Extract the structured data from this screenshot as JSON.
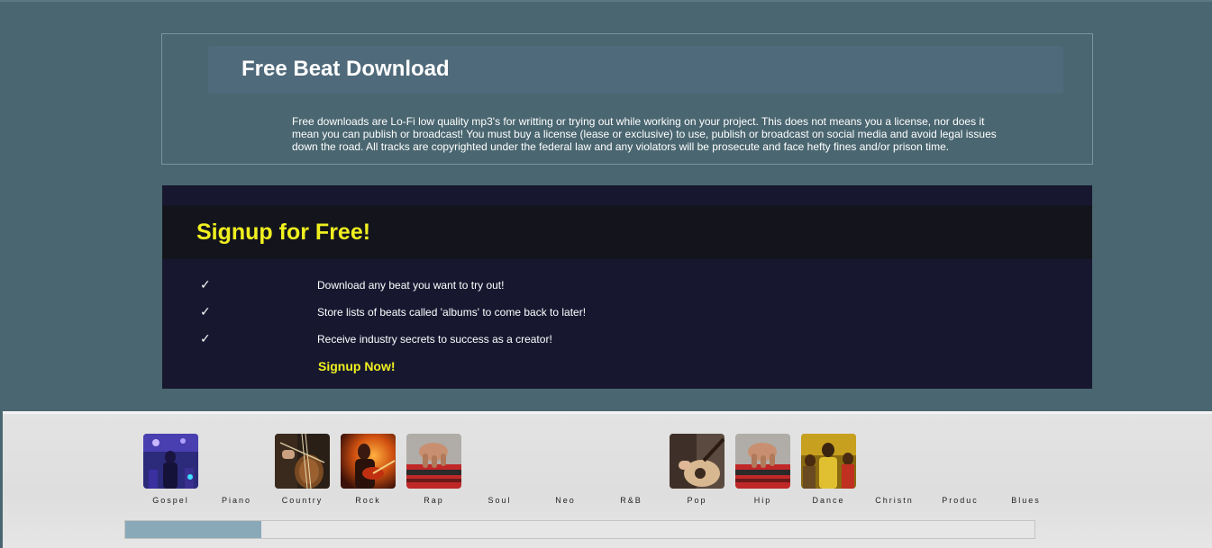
{
  "download": {
    "title": "Free Beat Download",
    "notice": "Free downloads are Lo-Fi low quality mp3's for writting or trying out while working on your project. This does not means you a license, nor does it mean you can publish or broadcast! You must buy a license (lease or exclusive) to use, publish or broadcast on social media and avoid legal issues down the road. All tracks are copyrighted under the federal law and any violators will be prosecute and face hefty fines and/or prison time."
  },
  "signup": {
    "title": "Signup for Free!",
    "check_symbol": "✓",
    "benefits": [
      "Download any beat you want to try out!",
      "Store lists of beats called 'albums' to come back to later!",
      "Receive industry secrets to success as a creator!"
    ],
    "cta": "Signup Now!"
  },
  "genres": [
    {
      "label": "Gospel",
      "thumb": "gospel-stage-icon"
    },
    {
      "label": "Piano",
      "thumb": ""
    },
    {
      "label": "Country",
      "thumb": "cello-icon"
    },
    {
      "label": "Rock",
      "thumb": "guitarist-icon"
    },
    {
      "label": "Rap",
      "thumb": "beat-pad-icon"
    },
    {
      "label": "Soul",
      "thumb": ""
    },
    {
      "label": "Neo",
      "thumb": ""
    },
    {
      "label": "R&B",
      "thumb": ""
    },
    {
      "label": "Pop",
      "thumb": "acoustic-guitar-icon"
    },
    {
      "label": "Hip",
      "thumb": "beat-pad-icon"
    },
    {
      "label": "Dance",
      "thumb": "dance-crowd-icon"
    },
    {
      "label": "Christn",
      "thumb": ""
    },
    {
      "label": "Produc",
      "thumb": ""
    },
    {
      "label": "Blues",
      "thumb": ""
    }
  ],
  "scroll_position": 0.15,
  "colors": {
    "page_bg": "#4a6670",
    "signup_bg": "#171830",
    "accent_yellow": "#f0f020",
    "strip_bg": "#e3e3e3"
  }
}
